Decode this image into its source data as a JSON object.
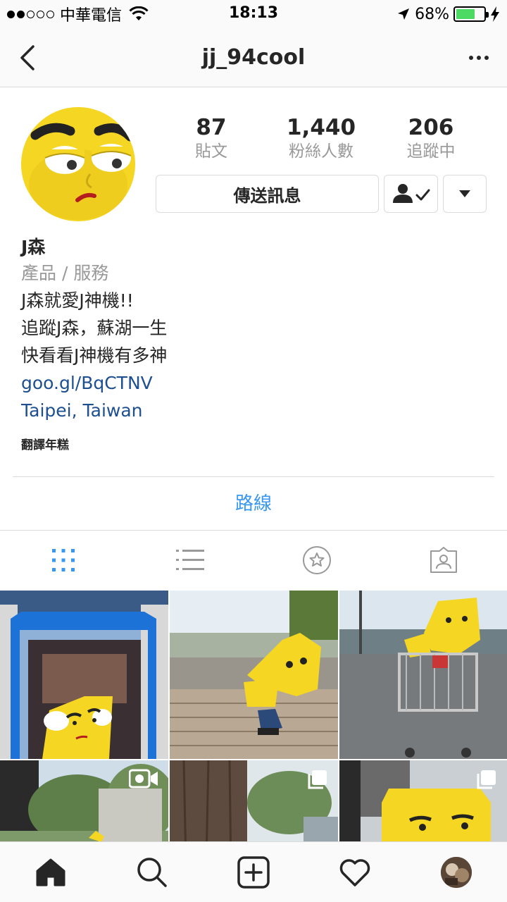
{
  "status_bar": {
    "carrier": "中華電信",
    "time": "18:13",
    "battery_percent": "68%",
    "battery_level": 0.68,
    "signal_bars_filled": 2,
    "signal_bars_total": 5
  },
  "nav": {
    "title": "jj_94cool",
    "back_icon": "chevron-left-icon",
    "more_icon": "more-horizontal-icon"
  },
  "stats": [
    {
      "value": "87",
      "label": "貼文"
    },
    {
      "value": "1,440",
      "label": "粉絲人數"
    },
    {
      "value": "206",
      "label": "追蹤中"
    }
  ],
  "actions": {
    "message_label": "傳送訊息",
    "following_icon": "person-check-icon",
    "dropdown_icon": "caret-down-icon"
  },
  "bio": {
    "name": "J森",
    "category": "產品 / 服務",
    "lines": [
      "J森就愛J神機!!",
      "追蹤J森，蘇湖一生",
      "快看看J神機有多神"
    ],
    "website": "goo.gl/BqCTNV",
    "location": "Taipei, Taiwan",
    "translate": "翻譯年糕"
  },
  "directions_label": "路線",
  "view_tabs": [
    "grid-icon",
    "list-icon",
    "star-circle-icon",
    "tagged-person-icon"
  ],
  "grid_badges": [
    "",
    "",
    "",
    "video-icon",
    "multi-photo-icon",
    "multi-photo-icon"
  ],
  "tabbar": [
    "home-icon",
    "search-icon",
    "add-icon",
    "heart-icon",
    "profile-avatar"
  ],
  "colors": {
    "link_blue": "#1d4f91",
    "accent_blue": "#3897f0",
    "mascot_yellow": "#f5d623",
    "battery_green": "#4cd964",
    "muted_gray": "#999999"
  }
}
